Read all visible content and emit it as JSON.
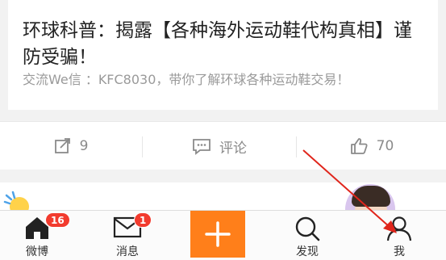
{
  "post": {
    "title": "环球科普：揭露【各种海外运动鞋代构真相】谨防受骗！",
    "desc": "交流We信 ：KFC8030，带你了解环球各种运动鞋交易！"
  },
  "actions": {
    "share_count": "9",
    "comment_label": "评论",
    "like_count": "70"
  },
  "tabbar": {
    "weibo": {
      "label": "微博",
      "badge": "16",
      "icon": "home-icon"
    },
    "messages": {
      "label": "消息",
      "badge": "1",
      "icon": "mail-icon"
    },
    "compose": {
      "icon": "plus-icon"
    },
    "discover": {
      "label": "发现",
      "icon": "search-icon"
    },
    "me": {
      "label": "我",
      "icon": "user-icon"
    }
  },
  "colors": {
    "accent": "#ff7f1a",
    "badge": "#f23b2e",
    "annotation_arrow": "#e0251b"
  }
}
